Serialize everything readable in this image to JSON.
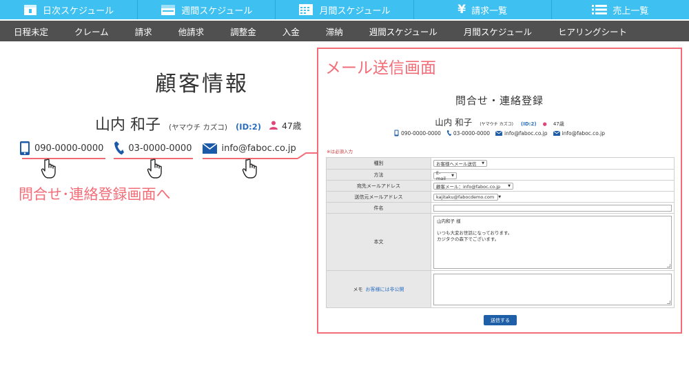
{
  "topnav": [
    {
      "label": "日次スケジュール",
      "icon": "calendar-day-icon"
    },
    {
      "label": "週間スケジュール",
      "icon": "calendar-week-icon"
    },
    {
      "label": "月間スケジュール",
      "icon": "calendar-month-icon"
    },
    {
      "label": "請求一覧",
      "icon": "yen-icon"
    },
    {
      "label": "売上一覧",
      "icon": "list-icon"
    }
  ],
  "subnav": [
    "日程未定",
    "クレーム",
    "請求",
    "他請求",
    "調整金",
    "入金",
    "滞納",
    "週間スケジュール",
    "月間スケジュール",
    "ヒアリングシート"
  ],
  "customer": {
    "page_title": "顧客情報",
    "name": "山内 和子",
    "kana": "(ヤマウチ カズコ)",
    "id": "(ID:2)",
    "age": "47歳",
    "mobile": "090-0000-0000",
    "tel": "03-0000-0000",
    "email": "info@faboc.co.jp"
  },
  "callout_left": "問合せ･連絡登録画面へ",
  "panel": {
    "label": "メール送信画面",
    "title": "問合せ・連絡登録",
    "name": "山内 和子",
    "kana": "(ヤマウチ カズコ)",
    "id": "(ID:2)",
    "age": "47歳",
    "mobile": "090-0000-0000",
    "tel": "03-0000-0000",
    "email1": "info@faboc.co.jp",
    "email2": "info@faboc.co.jp",
    "required_note": "※は必須入力",
    "form": {
      "type_label": "種別",
      "type_value": "お客様へメール送信",
      "method_label": "方法",
      "method_value": "E-mail",
      "to_label": "宛先メールアドレス",
      "to_value": "顧客メール：info@faboc.co.jp",
      "from_label": "送信元メールアドレス",
      "from_value": "kajitaku@fabocdemo.com",
      "subject_label": "件名",
      "subject_value": "",
      "body_label": "本文",
      "body_line1": "山内和子 様",
      "body_line2": "いつも大変お世話になっております。",
      "body_line3": "カジタクの森下でございます。",
      "memo_label": "メモ",
      "memo_note": "お客様には非公開"
    },
    "send_label": "送信する"
  },
  "colors": {
    "topnav_bg": "#3ec0f0",
    "subnav_bg": "#505050",
    "accent_pink": "#f26d78",
    "link_blue": "#2a6ec2",
    "button_blue": "#1f5fa8"
  }
}
